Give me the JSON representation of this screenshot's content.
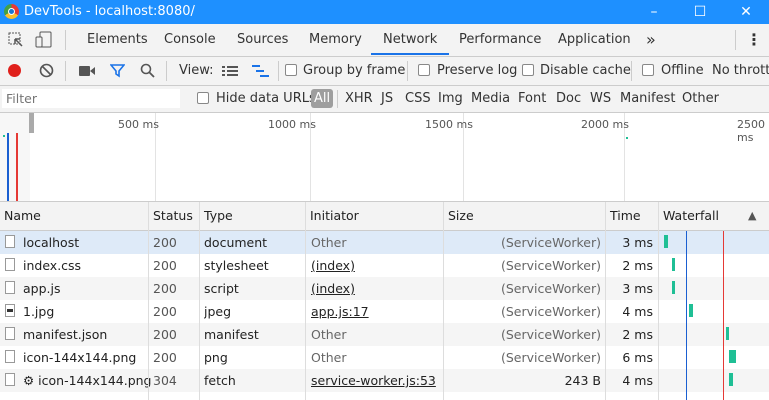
{
  "window": {
    "title": "DevTools - localhost:8080/",
    "minimize": "–",
    "maximize": "☐",
    "close": "✕"
  },
  "tabs": [
    {
      "label": "Elements"
    },
    {
      "label": "Console"
    },
    {
      "label": "Sources"
    },
    {
      "label": "Memory"
    },
    {
      "label": "Network"
    },
    {
      "label": "Performance"
    },
    {
      "label": "Application"
    }
  ],
  "more_tabs": "»",
  "kebab": "⋮",
  "toolbar": {
    "view_label": "View:",
    "group_by_frame": "Group by frame",
    "preserve_log": "Preserve log",
    "disable_cache": "Disable cache",
    "offline": "Offline",
    "throttling": "No throttling"
  },
  "filter": {
    "placeholder": "Filter",
    "hide_data_urls": "Hide data URLs",
    "types": [
      "All",
      "XHR",
      "JS",
      "CSS",
      "Img",
      "Media",
      "Font",
      "Doc",
      "WS",
      "Manifest",
      "Other"
    ]
  },
  "overview": {
    "ticks": [
      "500 ms",
      "1000 ms",
      "1500 ms",
      "2000 ms",
      "2500 ms"
    ]
  },
  "columns": {
    "name": "Name",
    "status": "Status",
    "type": "Type",
    "initiator": "Initiator",
    "size": "Size",
    "time": "Time",
    "waterfall": "Waterfall",
    "sort_icon": "▲"
  },
  "rows": [
    {
      "name": "localhost",
      "status": "200",
      "type": "document",
      "initiator": "Other",
      "size": "(ServiceWorker)",
      "time": "3 ms",
      "wf_start_ms": 0,
      "wf_duration_ms": 3
    },
    {
      "name": "index.css",
      "status": "200",
      "type": "stylesheet",
      "initiator": "(index)",
      "size": "(ServiceWorker)",
      "time": "2 ms",
      "wf_start_ms": 40,
      "wf_duration_ms": 2
    },
    {
      "name": "app.js",
      "status": "200",
      "type": "script",
      "initiator": "(index)",
      "size": "(ServiceWorker)",
      "time": "3 ms",
      "wf_start_ms": 40,
      "wf_duration_ms": 3
    },
    {
      "name": "1.jpg",
      "status": "200",
      "type": "jpeg",
      "initiator": "app.js:17",
      "size": "(ServiceWorker)",
      "time": "4 ms",
      "wf_start_ms": 130,
      "wf_duration_ms": 4
    },
    {
      "name": "manifest.json",
      "status": "200",
      "type": "manifest",
      "initiator": "Other",
      "size": "(ServiceWorker)",
      "time": "2 ms",
      "wf_start_ms": 325,
      "wf_duration_ms": 2
    },
    {
      "name": "icon-144x144.png",
      "status": "200",
      "type": "png",
      "initiator": "Other",
      "size": "(ServiceWorker)",
      "time": "6 ms",
      "wf_start_ms": 340,
      "wf_duration_ms": 6
    },
    {
      "name": "⚙ icon-144x144.png",
      "status": "304",
      "type": "fetch",
      "initiator": "service-worker.js:53",
      "size": "243 B",
      "time": "4 ms",
      "wf_start_ms": 340,
      "wf_duration_ms": 4
    }
  ],
  "colors": {
    "titlebar": "#1e90ff",
    "accent": "#1a73e8",
    "record": "#e0201b",
    "bar": "#1fbf95"
  }
}
